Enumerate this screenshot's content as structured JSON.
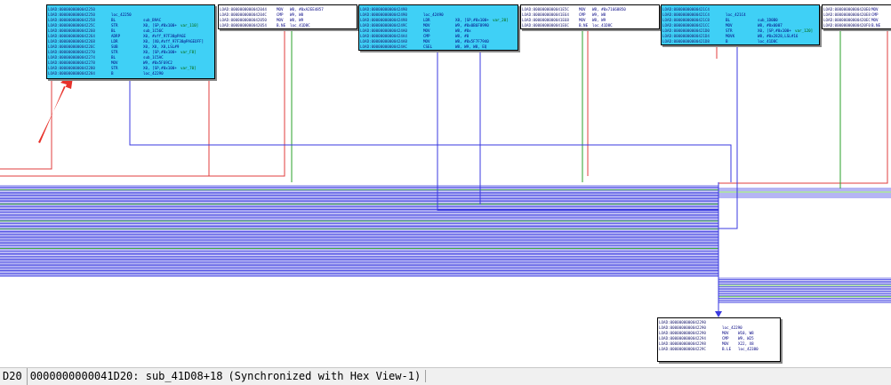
{
  "colors": {
    "edge_true": "#2aa02a",
    "edge_false": "#e03c3c",
    "edge_uncond": "#3a3ae0",
    "node_selected": "#3fd0f6",
    "arrow_annotation": "#e8312a"
  },
  "nodes": [
    {
      "id": "n1",
      "selected": true,
      "lines": [
        {
          "addr": "LOAD:0000000000042250",
          "mn": "",
          "op": "",
          "cm": ""
        },
        {
          "addr": "LOAD:0000000000042250",
          "mn": "loc_42250",
          "op": "",
          "cm": ""
        },
        {
          "addr": "LOAD:0000000000042258",
          "mn": "BL",
          "op": "sub_B9AC",
          "cm": ""
        },
        {
          "addr": "LOAD:000000000004225C",
          "mn": "STR",
          "op": "X0, [SP,#0x100+",
          "cm": "var_110]"
        },
        {
          "addr": "LOAD:0000000000042260",
          "mn": "BL",
          "op": "sub_1C56C",
          "cm": ""
        },
        {
          "addr": "LOAD:0000000000042264",
          "mn": "ADRP",
          "op": "X0, #off_97F38@PAGE",
          "cm": ""
        },
        {
          "addr": "LOAD:0000000000042268",
          "mn": "LDR",
          "op": "X0, [X0,#off_97F38@PAGEOFF]",
          "cm": ""
        },
        {
          "addr": "LOAD:000000000004226C",
          "mn": "SUB",
          "op": "X0, X0, X8,LSL#9",
          "cm": ""
        },
        {
          "addr": "LOAD:0000000000042270",
          "mn": "STR",
          "op": "X0, [SP,#0x100+",
          "cm": "var_F8]"
        },
        {
          "addr": "LOAD:0000000000042274",
          "mn": "BL",
          "op": "sub_1C5AC",
          "cm": ""
        },
        {
          "addr": "LOAD:0000000000042278",
          "mn": "MOV",
          "op": "W9, #0x5F69C2",
          "cm": ""
        },
        {
          "addr": "LOAD:0000000000042280",
          "mn": "STR",
          "op": "X0, [SP,#0x100+",
          "cm": "var_70]"
        },
        {
          "addr": "LOAD:0000000000042284",
          "mn": "B",
          "op": "loc_42290",
          "cm": ""
        }
      ]
    },
    {
      "id": "n2",
      "selected": false,
      "lines": [
        {
          "addr": "LOAD:0000000000042044",
          "mn": "MOV",
          "op": "W0, #0xA2EE4857",
          "cm": ""
        },
        {
          "addr": "LOAD:000000000004204C",
          "mn": "CMP",
          "op": "W9, W8",
          "cm": ""
        },
        {
          "addr": "LOAD:0000000000042050",
          "mn": "MOV",
          "op": "W8, W9",
          "cm": ""
        },
        {
          "addr": "LOAD:0000000000042054",
          "mn": "B.NE",
          "op": "loc_41D8C",
          "cm": ""
        }
      ]
    },
    {
      "id": "n3",
      "selected": true,
      "lines": [
        {
          "addr": "LOAD:0000000000042490",
          "mn": "",
          "op": "",
          "cm": ""
        },
        {
          "addr": "LOAD:0000000000042490",
          "mn": "loc_42490",
          "op": "",
          "cm": ""
        },
        {
          "addr": "LOAD:0000000000042498",
          "mn": "LDR",
          "op": "X8, [SP,#0x100+",
          "cm": "var_20]"
        },
        {
          "addr": "LOAD:000000000004249C",
          "mn": "MOV",
          "op": "W9, #0x0B6F8990",
          "cm": ""
        },
        {
          "addr": "LOAD:00000000000424A0",
          "mn": "MOV",
          "op": "W8, #0x",
          "cm": ""
        },
        {
          "addr": "LOAD:00000000000424A4",
          "mn": "CMP",
          "op": "W8, #0",
          "cm": ""
        },
        {
          "addr": "LOAD:00000000000424A8",
          "mn": "MOV",
          "op": "W8, #0x5F7F7940",
          "cm": ""
        },
        {
          "addr": "LOAD:00000000000424AC",
          "mn": "CSEL",
          "op": "W8, W9, W8, EQ",
          "cm": ""
        },
        {
          "addr": "LOAD:00000000000424B0",
          "mn": "B",
          "op": "loc_41D8C",
          "cm": ""
        }
      ]
    },
    {
      "id": "n4",
      "selected": false,
      "lines": [
        {
          "addr": "LOAD:0000000000041E5C",
          "mn": "MOV",
          "op": "W8, #0x71668850",
          "cm": ""
        },
        {
          "addr": "LOAD:0000000000041E64",
          "mn": "CMP",
          "op": "W9, W8",
          "cm": ""
        },
        {
          "addr": "LOAD:0000000000041E68",
          "mn": "MOV",
          "op": "W8, W9",
          "cm": ""
        },
        {
          "addr": "LOAD:0000000000041E6C",
          "mn": "B.NE",
          "op": "loc_41D8C",
          "cm": ""
        }
      ]
    },
    {
      "id": "n5",
      "selected": true,
      "lines": [
        {
          "addr": "LOAD:00000000000421C4",
          "mn": "",
          "op": "",
          "cm": ""
        },
        {
          "addr": "LOAD:00000000000421C4",
          "mn": "loc_421C4",
          "op": "",
          "cm": ""
        },
        {
          "addr": "LOAD:00000000000421C8",
          "mn": "BL",
          "op": "sub_1D0B0",
          "cm": ""
        },
        {
          "addr": "LOAD:00000000000421CC",
          "mn": "MOV",
          "op": "W8, #0x0007",
          "cm": ""
        },
        {
          "addr": "LOAD:00000000000421D0",
          "mn": "STR",
          "op": "X0, [SP,#0x100+",
          "cm": "var_120]"
        },
        {
          "addr": "LOAD:00000000000421D4",
          "mn": "MOVK",
          "op": "W8, #0x2828,LSL#16",
          "cm": ""
        },
        {
          "addr": "LOAD:00000000000421D8",
          "mn": "B",
          "op": "loc_41D8C",
          "cm": ""
        }
      ]
    },
    {
      "id": "n6",
      "selected": false,
      "lines": [
        {
          "addr": "LOAD:00000000000420E0",
          "mn": "MOV",
          "op": "",
          "cm": ""
        },
        {
          "addr": "LOAD:00000000000420E8",
          "mn": "CMP",
          "op": "",
          "cm": ""
        },
        {
          "addr": "LOAD:00000000000420EC",
          "mn": "MOV",
          "op": "",
          "cm": ""
        },
        {
          "addr": "LOAD:00000000000420F0",
          "mn": "B.NE",
          "op": "",
          "cm": ""
        }
      ]
    },
    {
      "id": "n7",
      "selected": false,
      "lines": [
        {
          "addr": "LOAD:0000000000042290",
          "mn": "",
          "op": "",
          "cm": ""
        },
        {
          "addr": "LOAD:0000000000042290",
          "mn": "loc_42290",
          "op": "",
          "cm": ""
        },
        {
          "addr": "LOAD:0000000000042290",
          "mn": "MOV",
          "op": "W10, W8",
          "cm": ""
        },
        {
          "addr": "LOAD:0000000000042294",
          "mn": "CMP",
          "op": "W9, W25",
          "cm": ""
        },
        {
          "addr": "LOAD:0000000000042298",
          "mn": "MOV",
          "op": "X22, X8",
          "cm": ""
        },
        {
          "addr": "LOAD:000000000004229C",
          "mn": "B.LE",
          "op": "loc_42380",
          "cm": ""
        }
      ]
    }
  ],
  "status_bar": {
    "cursor_short": "D20",
    "location": "0000000000041D20: sub_41D08+18",
    "sync": "(Synchronized with Hex View-1)"
  }
}
